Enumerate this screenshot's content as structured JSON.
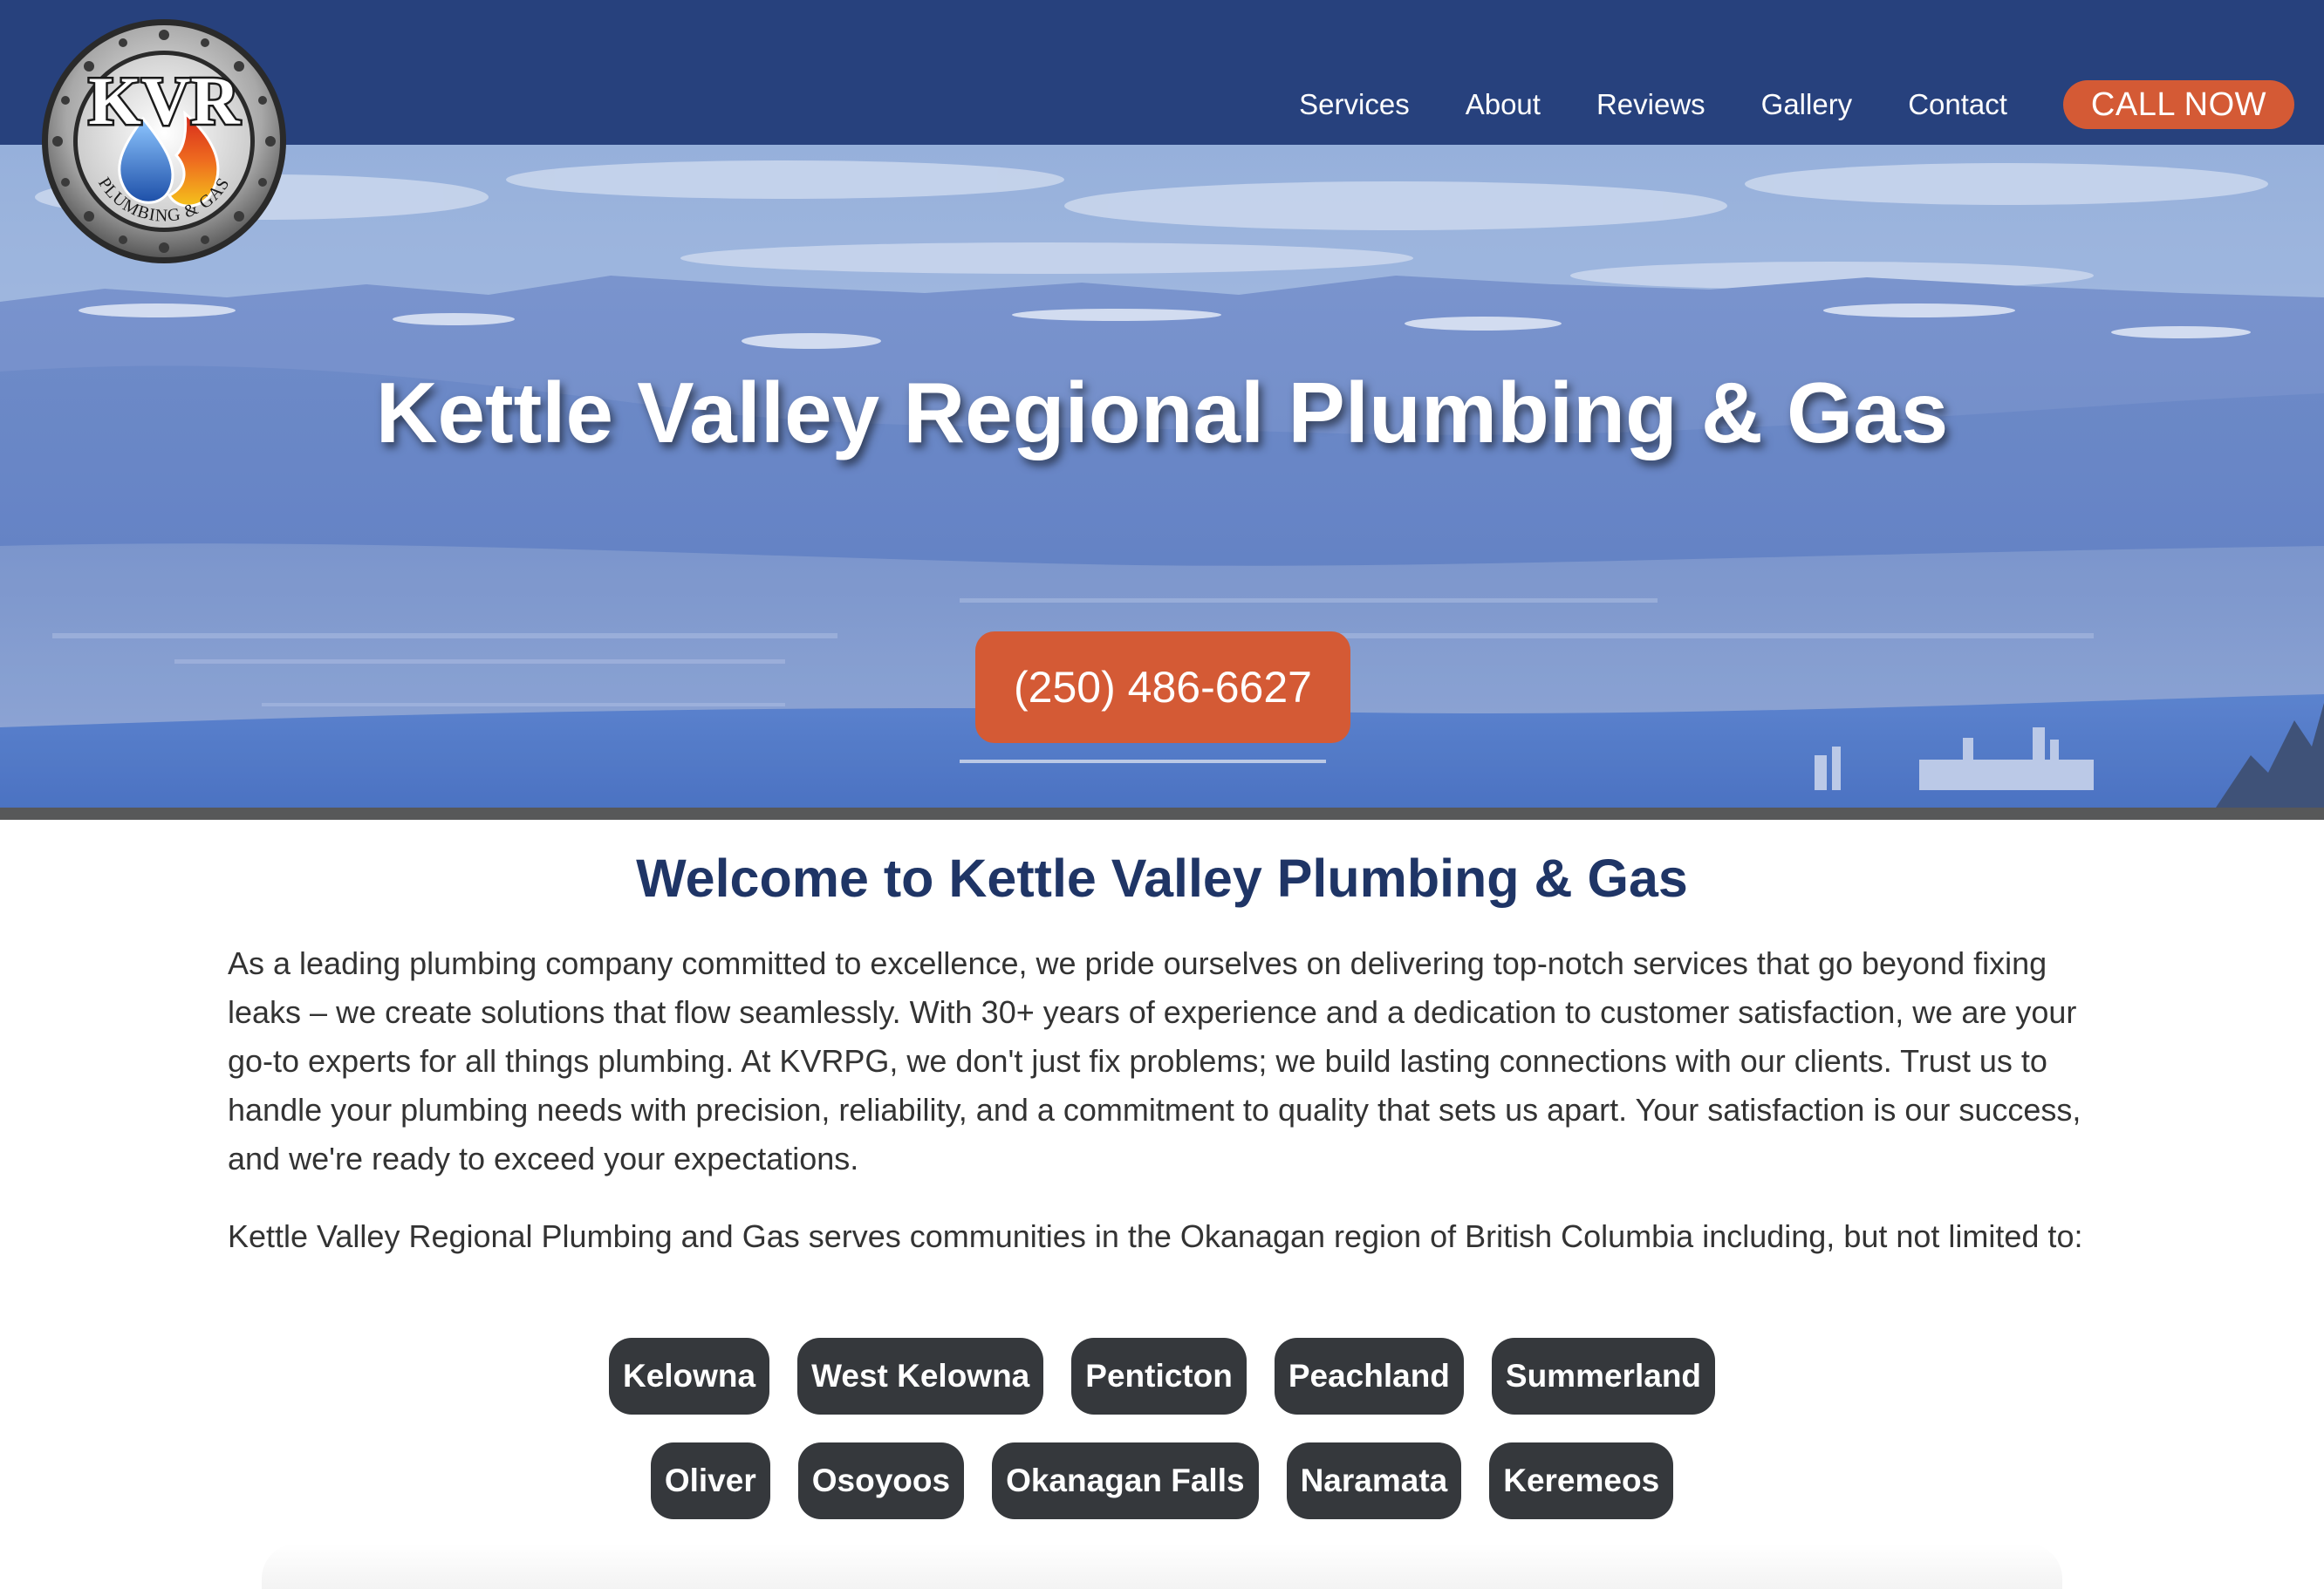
{
  "brand": {
    "logo_text": "KVR",
    "logo_subtext": "PLUMBING & GAS"
  },
  "nav": {
    "items": [
      {
        "label": "Services"
      },
      {
        "label": "About"
      },
      {
        "label": "Reviews"
      },
      {
        "label": "Gallery"
      },
      {
        "label": "Contact"
      }
    ],
    "cta_label": "CALL NOW"
  },
  "hero": {
    "title": "Kettle Valley Regional Plumbing & Gas",
    "phone": "(250) 486-6627"
  },
  "welcome": {
    "title": "Welcome to Kettle Valley Plumbing & Gas",
    "paragraph1": "As a leading plumbing company committed to excellence, we pride ourselves on delivering top-notch services that go beyond fixing leaks – we create solutions that flow seamlessly. With 30+ years of experience and a dedication to customer satisfaction, we are your go-to experts for all things plumbing. At KVRPG, we don't just fix problems; we build lasting connections with our clients. Trust us to handle your plumbing needs with precision, reliability, and a commitment to quality that sets us apart. Your satisfaction is our success, and we're ready to exceed your expectations.",
    "paragraph2": "Kettle Valley Regional Plumbing and Gas serves communities in the Okanagan region of British Columbia including, but not limited to:"
  },
  "communities": {
    "row1": [
      "Kelowna",
      "West Kelowna",
      "Penticton",
      "Peachland",
      "Summerland"
    ],
    "row2": [
      "Oliver",
      "Osoyoos",
      "Okanagan Falls",
      "Naramata",
      "Keremeos"
    ]
  },
  "colors": {
    "nav_bg": "#27417d",
    "accent": "#d45a35",
    "heading": "#1f3566",
    "pill_bg": "#35383c"
  }
}
